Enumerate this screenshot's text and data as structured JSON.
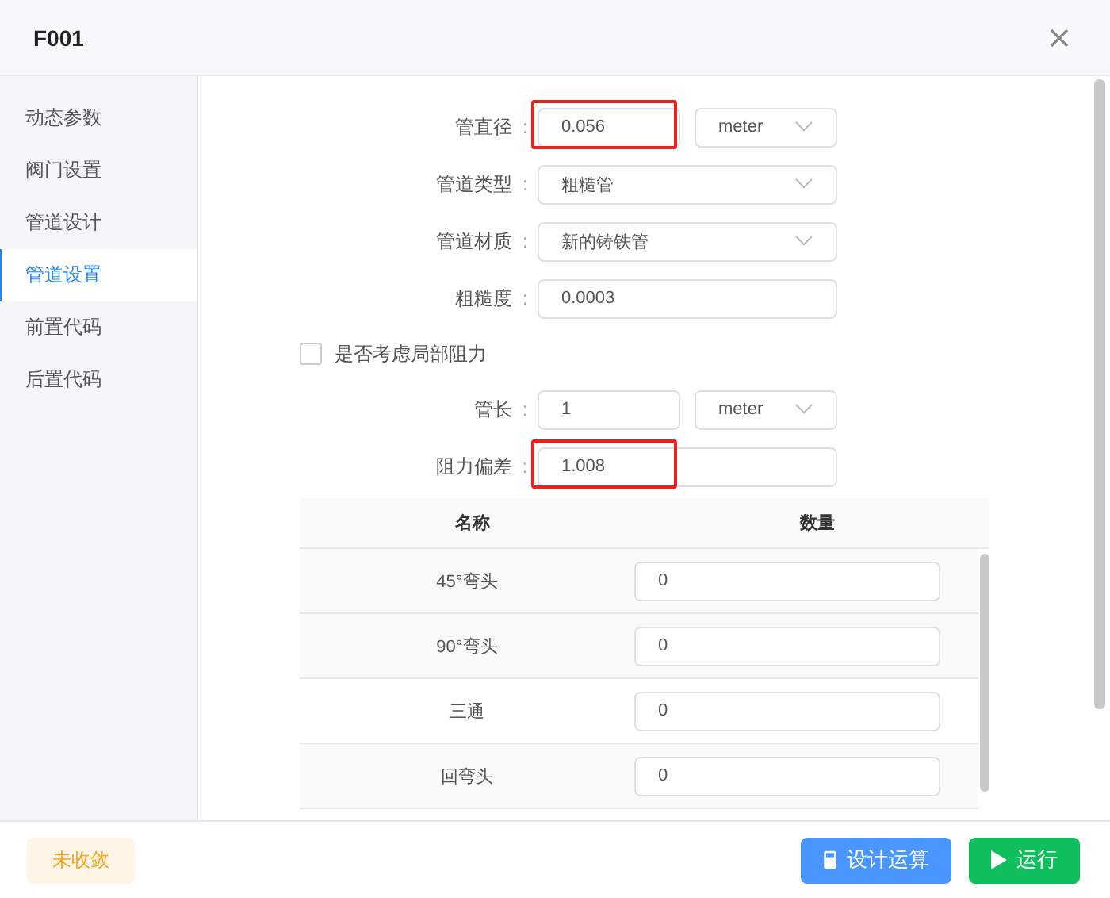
{
  "window": {
    "title": "F001"
  },
  "sidebar": {
    "items": [
      {
        "label": "动态参数",
        "selected": false
      },
      {
        "label": "阀门设置",
        "selected": false
      },
      {
        "label": "管道设计",
        "selected": false
      },
      {
        "label": "管道设置",
        "selected": true
      },
      {
        "label": "前置代码",
        "selected": false
      },
      {
        "label": "后置代码",
        "selected": false
      }
    ]
  },
  "form": {
    "fields": [
      {
        "kind": "input_unit",
        "label": "管直径",
        "value": "0.056",
        "unit": "meter",
        "highlighted": true,
        "separator": ":"
      },
      {
        "kind": "select",
        "label": "管道类型",
        "value": "粗糙管",
        "highlighted": false,
        "separator": ":"
      },
      {
        "kind": "select",
        "label": "管道材质",
        "value": "新的铸铁管",
        "highlighted": false,
        "separator": ":"
      },
      {
        "kind": "input",
        "label": "粗糙度",
        "value": "0.0003",
        "highlighted": false,
        "separator": ":"
      },
      {
        "kind": "checkbox",
        "label": "是否考虑局部阻力",
        "checked": false
      },
      {
        "kind": "input_unit",
        "label": "管长",
        "value": "1",
        "unit": "meter",
        "highlighted": false,
        "separator": ":"
      },
      {
        "kind": "input",
        "label": "阻力偏差",
        "value": "1.008",
        "highlighted": true,
        "separator": ":"
      }
    ]
  },
  "table": {
    "columns": [
      "名称",
      "数量"
    ],
    "rows": [
      {
        "name": "45°弯头",
        "quantity": "0"
      },
      {
        "name": "90°弯头",
        "quantity": "0"
      },
      {
        "name": "三通",
        "quantity": "0"
      },
      {
        "name": "回弯头",
        "quantity": "0"
      }
    ]
  },
  "footer": {
    "status": "未收敛",
    "buttons": [
      {
        "kind": "primary",
        "label": "设计运算"
      },
      {
        "kind": "success",
        "label": "运行"
      }
    ]
  }
}
